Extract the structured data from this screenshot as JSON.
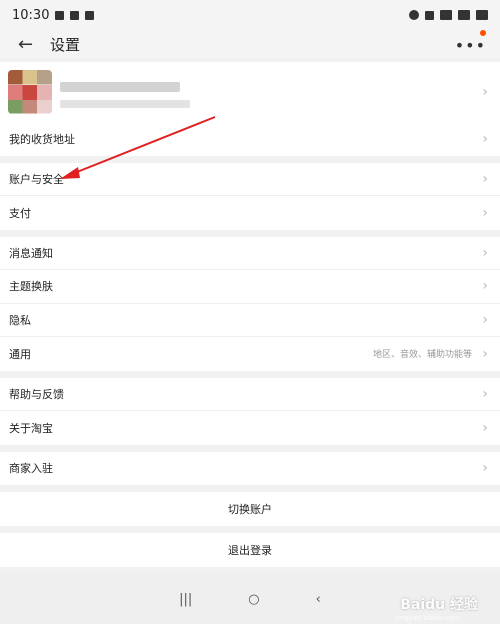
{
  "status_bar": {
    "time": "10:30"
  },
  "header": {
    "back_icon": "←",
    "title": "设置",
    "more_icon": "•••"
  },
  "menu": {
    "group1": [
      {
        "label": "我的收货地址"
      }
    ],
    "group2": [
      {
        "label": "账户与安全"
      },
      {
        "label": "支付"
      }
    ],
    "group3": [
      {
        "label": "消息通知"
      },
      {
        "label": "主题换肤"
      },
      {
        "label": "隐私"
      },
      {
        "label": "通用",
        "detail": "地区、音效、辅助功能等"
      }
    ],
    "group4": [
      {
        "label": "帮助与反馈"
      },
      {
        "label": "关于淘宝"
      }
    ],
    "group5": [
      {
        "label": "商家入驻"
      }
    ]
  },
  "actions": {
    "switch_account": "切换账户",
    "logout": "退出登录"
  },
  "nav": {
    "recent": "|||",
    "home": "○",
    "back": "‹"
  },
  "watermark": {
    "text": "Baidu 经验",
    "url": "jingyan.baidu.com"
  },
  "colors": {
    "notification_dot": "#ff5000",
    "annotation_arrow": "#e02020"
  }
}
